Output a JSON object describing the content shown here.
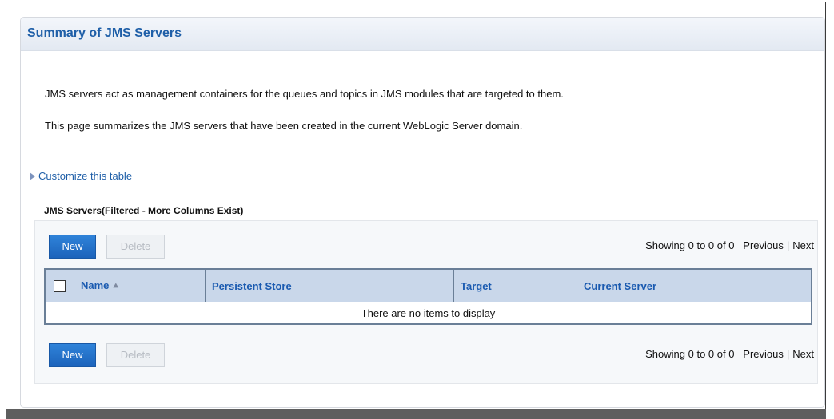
{
  "page": {
    "title": "Summary of JMS Servers",
    "description_1": "JMS servers act as management containers for the queues and topics in JMS modules that are targeted to them.",
    "description_2": "This page summarizes the JMS servers that have been created in the current WebLogic Server domain.",
    "customize_link": "Customize this table"
  },
  "table": {
    "caption": "JMS Servers(Filtered - More Columns Exist)",
    "columns": [
      "Name",
      "Persistent Store",
      "Target",
      "Current Server"
    ],
    "sort_indicator_icon": "sort-ascending-icon",
    "empty_message": "There are no items to display",
    "rows": []
  },
  "toolbar": {
    "new_label": "New",
    "delete_label": "Delete"
  },
  "pager": {
    "showing": "Showing 0 to 0 of 0",
    "previous": "Previous",
    "separator": "|",
    "next": "Next"
  },
  "colors": {
    "title": "#1f5fa8",
    "header_bg": "#c9d7ea",
    "new_button": "#2f83d9"
  }
}
